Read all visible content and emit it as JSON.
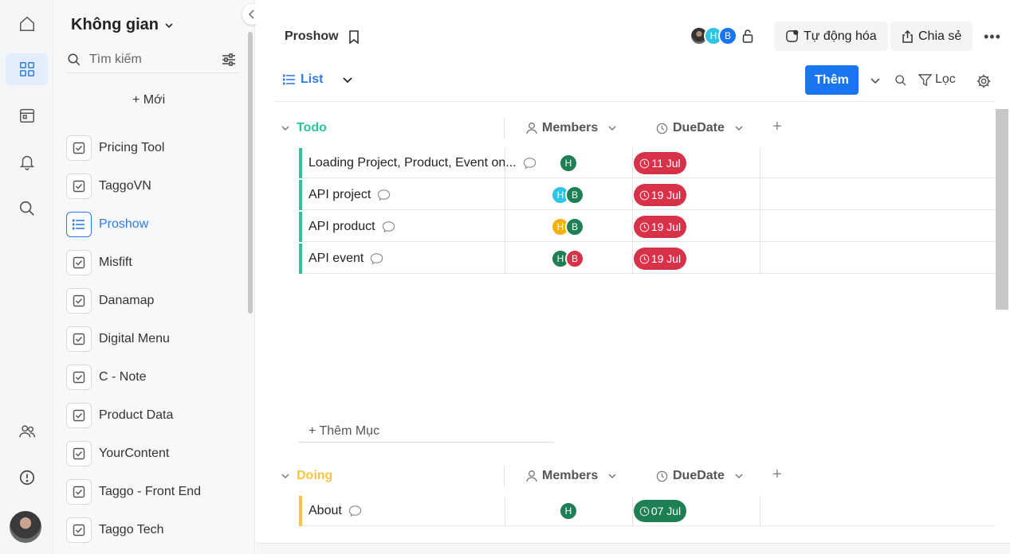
{
  "rail": {
    "items": [
      "home",
      "spaces",
      "calendar",
      "notifications",
      "search"
    ],
    "active": "spaces"
  },
  "sidebar": {
    "title": "Không gian",
    "search_placeholder": "Tìm kiếm",
    "new_label": "+ Mới",
    "items": [
      {
        "label": "Pricing Tool",
        "icon": "checkbox-icon"
      },
      {
        "label": "TaggoVN",
        "icon": "checkbox-icon"
      },
      {
        "label": "Proshow",
        "icon": "list-icon",
        "active": true
      },
      {
        "label": "Misfift",
        "icon": "checkbox-icon"
      },
      {
        "label": "Danamap",
        "icon": "checkbox-icon"
      },
      {
        "label": "Digital Menu",
        "icon": "checkbox-icon"
      },
      {
        "label": "C - Note",
        "icon": "checkbox-icon"
      },
      {
        "label": "Product Data",
        "icon": "checkbox-icon"
      },
      {
        "label": "YourContent",
        "icon": "checkbox-icon"
      },
      {
        "label": "Taggo - Front End",
        "icon": "checkbox-icon"
      },
      {
        "label": "Taggo Tech",
        "icon": "checkbox-icon"
      }
    ]
  },
  "header": {
    "title": "Proshow",
    "avatars": [
      {
        "initial": "",
        "color": "#444444"
      },
      {
        "initial": "H",
        "color": "#2ec4e6"
      },
      {
        "initial": "B",
        "color": "#1976f0"
      }
    ],
    "automation_label": "Tự động hóa",
    "share_label": "Chia sẻ",
    "more_label": "•••"
  },
  "toolbar": {
    "view_label": "List",
    "add_label": "Thêm",
    "filter_label": "Lọc"
  },
  "groups": [
    {
      "name": "Todo",
      "color": "#2bc49a",
      "columns": [
        "Members",
        "DueDate"
      ],
      "rows": [
        {
          "name": "Loading Project, Product, Event on...",
          "members": [
            {
              "initial": "H",
              "color": "#1e7f52"
            }
          ],
          "due": "11 Jul",
          "due_color": "#d8324a"
        },
        {
          "name": "API project",
          "members": [
            {
              "initial": "H",
              "color": "#2ec4e6"
            },
            {
              "initial": "B",
              "color": "#1e7f52"
            }
          ],
          "due": "19 Jul",
          "due_color": "#d8324a"
        },
        {
          "name": "API product",
          "members": [
            {
              "initial": "H",
              "color": "#f2b10c"
            },
            {
              "initial": "B",
              "color": "#1e7f52"
            }
          ],
          "due": "19 Jul",
          "due_color": "#d8324a"
        },
        {
          "name": "API event",
          "members": [
            {
              "initial": "H",
              "color": "#1e7f52"
            },
            {
              "initial": "B",
              "color": "#d8324a"
            }
          ],
          "due": "19 Jul",
          "due_color": "#d8324a"
        }
      ],
      "add_item_label": "+ Thêm Mục"
    },
    {
      "name": "Doing",
      "color": "#f6c343",
      "columns": [
        "Members",
        "DueDate"
      ],
      "rows": [
        {
          "name": "About",
          "members": [
            {
              "initial": "H",
              "color": "#1e7f52"
            }
          ],
          "due": "07 Jul",
          "due_color": "#1e7f52"
        }
      ]
    }
  ]
}
